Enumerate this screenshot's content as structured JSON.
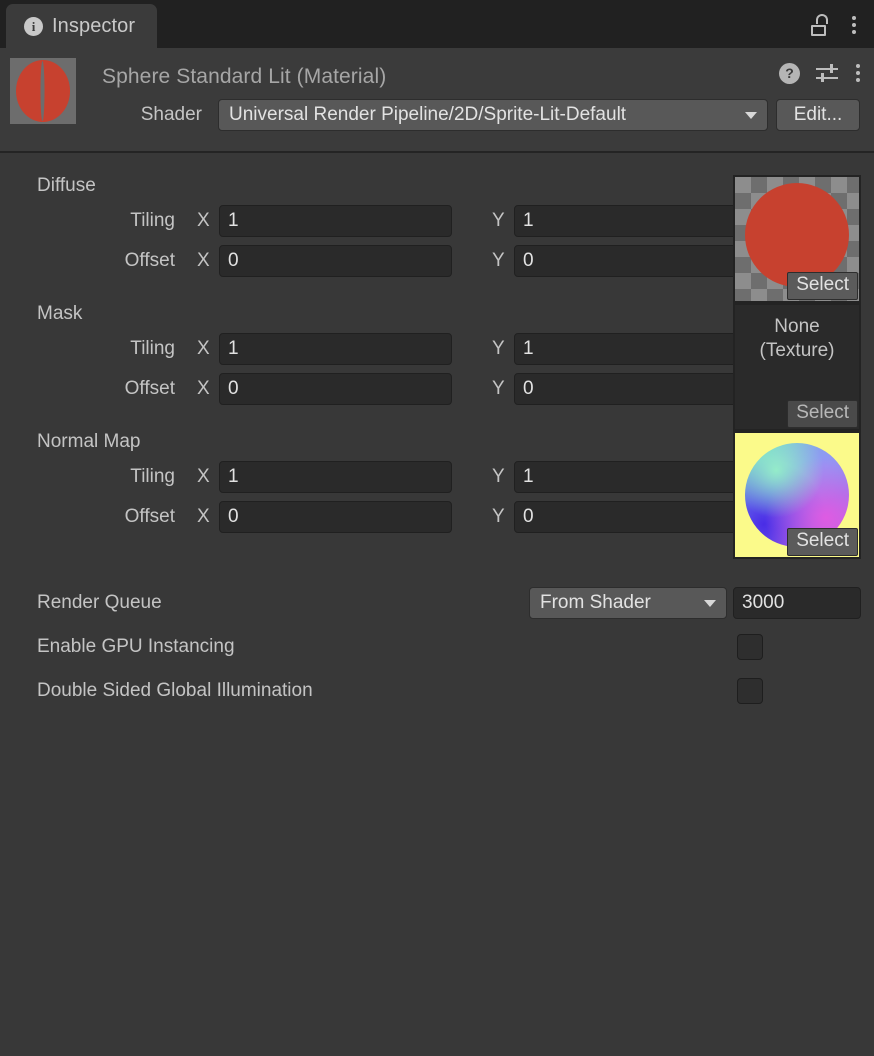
{
  "tabbar": {
    "tab_label": "Inspector",
    "info_icon": "info-icon",
    "lock_icon": "unlocked-padlock-icon",
    "menu_icon": "kebab-menu-icon"
  },
  "header": {
    "title": "Sphere Standard Lit (Material)",
    "preview_icon": "material-preview-sphere",
    "help_icon": "help-icon",
    "help_glyph": "?",
    "preset_icon": "preset-settings-icon",
    "menu_icon": "kebab-menu-icon",
    "shader_label": "Shader",
    "shader_value": "Universal Render Pipeline/2D/Sprite-Lit-Default",
    "edit_label": "Edit..."
  },
  "sections": [
    {
      "title": "Diffuse",
      "tiling_label": "Tiling",
      "offset_label": "Offset",
      "x_label": "X",
      "y_label": "Y",
      "tiling_x": "1",
      "tiling_y": "1",
      "offset_x": "0",
      "offset_y": "0",
      "texture_kind": "image",
      "texture_value": "",
      "select_label": "Select"
    },
    {
      "title": "Mask",
      "tiling_label": "Tiling",
      "offset_label": "Offset",
      "x_label": "X",
      "y_label": "Y",
      "tiling_x": "1",
      "tiling_y": "1",
      "offset_x": "0",
      "offset_y": "0",
      "texture_kind": "none",
      "texture_value": "None\n(Texture)",
      "none_line1": "None",
      "none_line2": "(Texture)",
      "select_label": "Select"
    },
    {
      "title": "Normal Map",
      "tiling_label": "Tiling",
      "offset_label": "Offset",
      "x_label": "X",
      "y_label": "Y",
      "tiling_x": "1",
      "tiling_y": "1",
      "offset_x": "0",
      "offset_y": "0",
      "texture_kind": "image",
      "texture_value": "",
      "select_label": "Select"
    }
  ],
  "settings": {
    "render_queue_label": "Render Queue",
    "render_queue_mode": "From Shader",
    "render_queue_value": "3000",
    "gpu_instancing_label": "Enable GPU Instancing",
    "gpu_instancing_checked": false,
    "double_sided_label": "Double Sided Global Illumination",
    "double_sided_checked": false
  },
  "colors": {
    "window_bg": "#383838",
    "header_bg": "#3b3b3b",
    "tabbar_bg": "#212121",
    "field_bg": "#2a2a2a",
    "button_bg": "#585858",
    "text": "#c4c4c4",
    "material_red": "#c7412f",
    "normal_map_bg": "#fbfa8a"
  }
}
